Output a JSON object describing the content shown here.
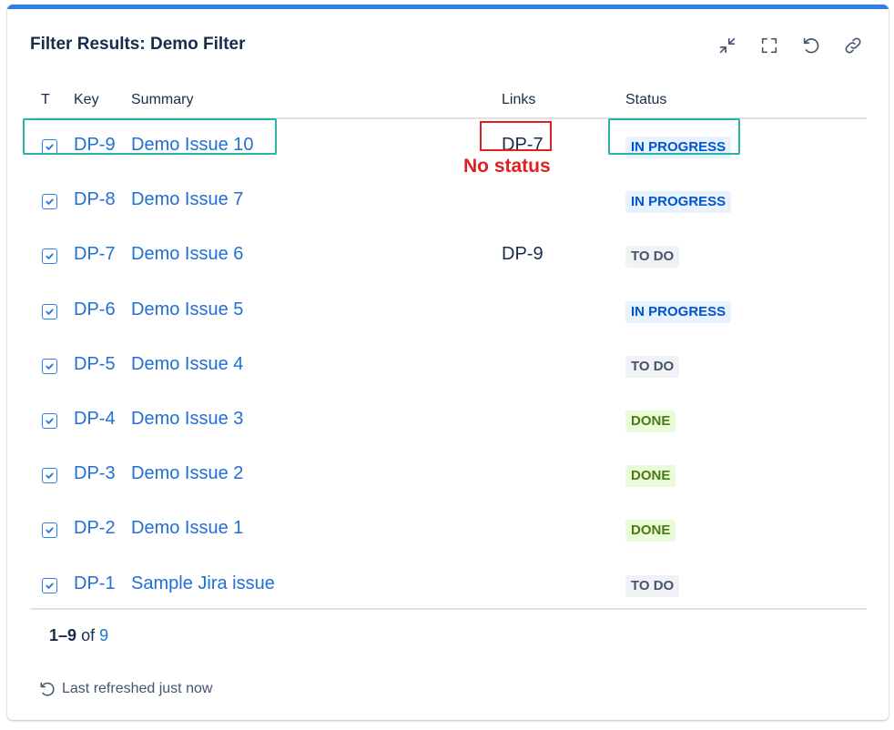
{
  "gadget": {
    "title": "Filter Results: Demo Filter",
    "toolbar": [
      {
        "icon": "minimize-icon"
      },
      {
        "icon": "fullscreen-icon"
      },
      {
        "icon": "refresh-icon"
      },
      {
        "icon": "link-icon"
      }
    ]
  },
  "columns": {
    "type": "T",
    "key": "Key",
    "summary": "Summary",
    "links": "Links",
    "status": "Status"
  },
  "rows": [
    {
      "type_icon": "task-checkbox-icon",
      "key": "DP-9",
      "summary": "Demo Issue 10",
      "links": "DP-7",
      "status": "IN PROGRESS"
    },
    {
      "type_icon": "task-checkbox-icon",
      "key": "DP-8",
      "summary": "Demo Issue 7",
      "links": "",
      "status": "IN PROGRESS"
    },
    {
      "type_icon": "task-checkbox-icon",
      "key": "DP-7",
      "summary": "Demo Issue 6",
      "links": "DP-9",
      "status": "TO DO"
    },
    {
      "type_icon": "task-checkbox-icon",
      "key": "DP-6",
      "summary": "Demo Issue 5",
      "links": "",
      "status": "IN PROGRESS"
    },
    {
      "type_icon": "task-checkbox-icon",
      "key": "DP-5",
      "summary": "Demo Issue 4",
      "links": "",
      "status": "TO DO"
    },
    {
      "type_icon": "task-checkbox-icon",
      "key": "DP-4",
      "summary": "Demo Issue 3",
      "links": "",
      "status": "DONE"
    },
    {
      "type_icon": "task-checkbox-icon",
      "key": "DP-3",
      "summary": "Demo Issue 2",
      "links": "",
      "status": "DONE"
    },
    {
      "type_icon": "task-checkbox-icon",
      "key": "DP-2",
      "summary": "Demo Issue 1",
      "links": "",
      "status": "DONE"
    },
    {
      "type_icon": "task-checkbox-icon",
      "key": "DP-1",
      "summary": "Sample Jira issue",
      "links": "",
      "status": "TO DO"
    }
  ],
  "annotation": {
    "text": "No status",
    "color": "#e02020",
    "highlight_color": "#26b5a4"
  },
  "footer": {
    "range": "1–9",
    "of_label": "of",
    "total": "9",
    "refreshed": "Last refreshed just now"
  },
  "colors": {
    "accent": "#2f80e5",
    "link": "#1f6fd6",
    "in_progress": "#0055cc",
    "done": "#4a7a15",
    "todo": "#44546f"
  }
}
